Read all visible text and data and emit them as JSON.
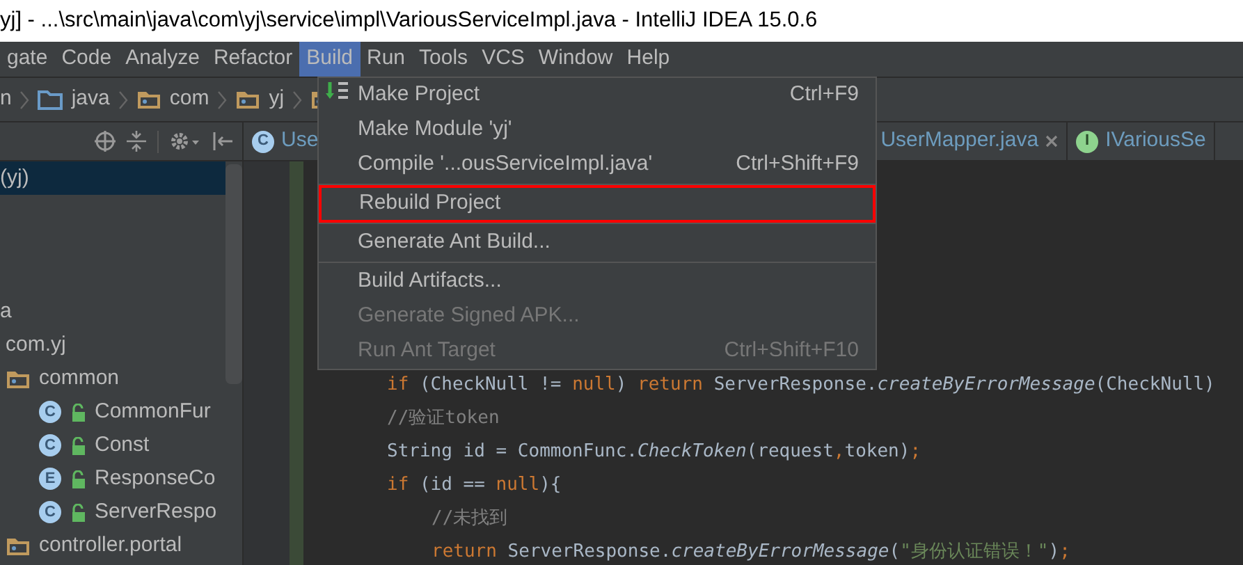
{
  "window": {
    "title": "yj] - ...\\src\\main\\java\\com\\yj\\service\\impl\\VariousServiceImpl.java - IntelliJ IDEA 15.0.6"
  },
  "menu_bar": [
    {
      "label": "gate",
      "selected": false
    },
    {
      "label": "Code",
      "selected": false
    },
    {
      "label": "Analyze",
      "selected": false
    },
    {
      "label": "Refactor",
      "selected": false
    },
    {
      "label": "Build",
      "selected": true
    },
    {
      "label": "Run",
      "selected": false
    },
    {
      "label": "Tools",
      "selected": false
    },
    {
      "label": "VCS",
      "selected": false
    },
    {
      "label": "Window",
      "selected": false
    },
    {
      "label": "Help",
      "selected": false
    }
  ],
  "breadcrumbs": [
    {
      "label": "n",
      "kind": "text"
    },
    {
      "label": "java",
      "kind": "source-folder"
    },
    {
      "label": "com",
      "kind": "package"
    },
    {
      "label": "yj",
      "kind": "package"
    }
  ],
  "project_tree": [
    {
      "label": "(yj)",
      "selected": true
    },
    {
      "label": "a",
      "selected": false,
      "children": [
        {
          "label": "com.yj",
          "selected": false,
          "children": [
            {
              "label": "common",
              "selected": false,
              "children": [
                {
                  "label": "CommonFur",
                  "badge": "C",
                  "selected": false
                },
                {
                  "label": "Const",
                  "badge": "C",
                  "selected": false
                },
                {
                  "label": "ResponseCo",
                  "badge": "E",
                  "selected": false
                },
                {
                  "label": "ServerRespo",
                  "badge": "C",
                  "selected": false
                }
              ]
            },
            {
              "label": "controller.portal",
              "selected": false
            }
          ]
        }
      ]
    }
  ],
  "editor_tabs": [
    {
      "label": "Use",
      "badge": "C",
      "selected": false
    },
    {
      "label": "UserMapper.java",
      "selected": false,
      "closable": true
    },
    {
      "label": "IVariousSe",
      "badge": "I",
      "selected": false
    }
  ],
  "code": [
    {
      "tokens": [
        {
          "kind": "keyword",
          "text": "if"
        },
        {
          "kind": "plain",
          "text": " (CheckNull != "
        },
        {
          "kind": "keyword",
          "text": "null"
        },
        {
          "kind": "plain",
          "text": ") "
        },
        {
          "kind": "keyword",
          "text": "return"
        },
        {
          "kind": "plain",
          "text": " ServerResponse."
        },
        {
          "kind": "method",
          "text": "createByErrorMessage"
        },
        {
          "kind": "plain",
          "text": "(CheckNull)"
        }
      ]
    },
    {
      "tokens": [
        {
          "kind": "comment",
          "text": "//验证token"
        }
      ]
    },
    {
      "tokens": [
        {
          "kind": "plain",
          "text": "String id = CommonFunc."
        },
        {
          "kind": "method",
          "text": "CheckToken"
        },
        {
          "kind": "plain",
          "text": "(request"
        },
        {
          "kind": "keyword",
          "text": ","
        },
        {
          "kind": "plain",
          "text": "token)"
        },
        {
          "kind": "keyword",
          "text": ";"
        }
      ]
    },
    {
      "tokens": [
        {
          "kind": "keyword",
          "text": "if"
        },
        {
          "kind": "plain",
          "text": " (id == "
        },
        {
          "kind": "keyword",
          "text": "null"
        },
        {
          "kind": "plain",
          "text": "){"
        }
      ],
      "children": [
        {
          "tokens": [
            {
              "kind": "comment",
              "text": "//未找到"
            }
          ]
        },
        {
          "tokens": [
            {
              "kind": "keyword",
              "text": "return"
            },
            {
              "kind": "plain",
              "text": " ServerResponse."
            },
            {
              "kind": "method",
              "text": "createByErrorMessage"
            },
            {
              "kind": "plain",
              "text": "("
            },
            {
              "kind": "string",
              "text": "\"身份认证错误！\""
            },
            {
              "kind": "plain",
              "text": ")"
            },
            {
              "kind": "keyword",
              "text": ";"
            }
          ]
        }
      ]
    }
  ],
  "build_menu": [
    {
      "kind": "item",
      "label": "Make Project",
      "shortcut": "Ctrl+F9",
      "disabled": false,
      "outlined": false
    },
    {
      "kind": "item",
      "label": "Make Module 'yj'",
      "disabled": false,
      "outlined": false
    },
    {
      "kind": "item",
      "label": "Compile '...ousServiceImpl.java'",
      "shortcut": "Ctrl+Shift+F9",
      "disabled": false,
      "outlined": false
    },
    {
      "kind": "separator"
    },
    {
      "kind": "item",
      "label": "Rebuild Project",
      "disabled": false,
      "outlined": true
    },
    {
      "kind": "separator"
    },
    {
      "kind": "item",
      "label": "Generate Ant Build...",
      "disabled": false,
      "outlined": false
    },
    {
      "kind": "separator"
    },
    {
      "kind": "item",
      "label": "Build Artifacts...",
      "disabled": false,
      "outlined": false
    },
    {
      "kind": "item",
      "label": "Generate Signed APK...",
      "disabled": true,
      "outlined": false
    },
    {
      "kind": "item",
      "label": "Run Ant Target",
      "shortcut": "Ctrl+Shift+F10",
      "disabled": true,
      "outlined": false
    }
  ]
}
